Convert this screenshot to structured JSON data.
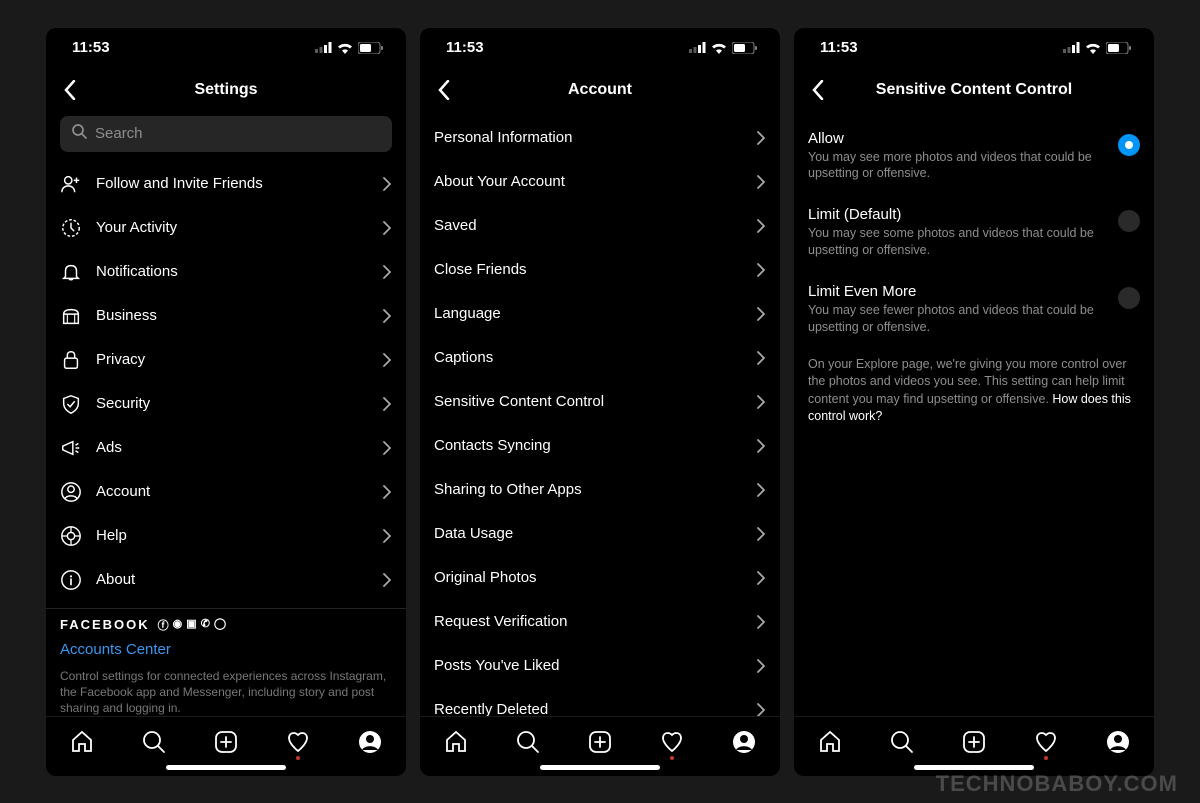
{
  "watermark": "TECHNOBABOY.COM",
  "status_time": "11:53",
  "screen1": {
    "title": "Settings",
    "search_placeholder": "Search",
    "items": [
      {
        "icon": "follow",
        "label": "Follow and Invite Friends"
      },
      {
        "icon": "activity",
        "label": "Your Activity"
      },
      {
        "icon": "bell",
        "label": "Notifications"
      },
      {
        "icon": "business",
        "label": "Business"
      },
      {
        "icon": "lock",
        "label": "Privacy"
      },
      {
        "icon": "shield",
        "label": "Security"
      },
      {
        "icon": "megaphone",
        "label": "Ads"
      },
      {
        "icon": "person",
        "label": "Account"
      },
      {
        "icon": "help",
        "label": "Help"
      },
      {
        "icon": "info",
        "label": "About"
      }
    ],
    "fb_brand": "FACEBOOK",
    "accounts_center": "Accounts Center",
    "fb_desc": "Control settings for connected experiences across Instagram, the Facebook app and Messenger, including story and post sharing and logging in."
  },
  "screen2": {
    "title": "Account",
    "items": [
      "Personal Information",
      "About Your Account",
      "Saved",
      "Close Friends",
      "Language",
      "Captions",
      "Sensitive Content Control",
      "Contacts Syncing",
      "Sharing to Other Apps",
      "Data Usage",
      "Original Photos",
      "Request Verification",
      "Posts You've Liked",
      "Recently Deleted"
    ]
  },
  "screen3": {
    "title": "Sensitive Content Control",
    "options": [
      {
        "title": "Allow",
        "desc": "You may see more photos and videos that could be upsetting or offensive.",
        "selected": true
      },
      {
        "title": "Limit (Default)",
        "desc": "You may see some photos and videos that could be upsetting or offensive.",
        "selected": false
      },
      {
        "title": "Limit Even More",
        "desc": "You may see fewer photos and videos that could be upsetting or offensive.",
        "selected": false
      }
    ],
    "info": "On your Explore page, we're giving you more control over the photos and videos you see. This setting can help limit content you may find upsetting or offensive.",
    "info_link": "How does this control work?"
  }
}
